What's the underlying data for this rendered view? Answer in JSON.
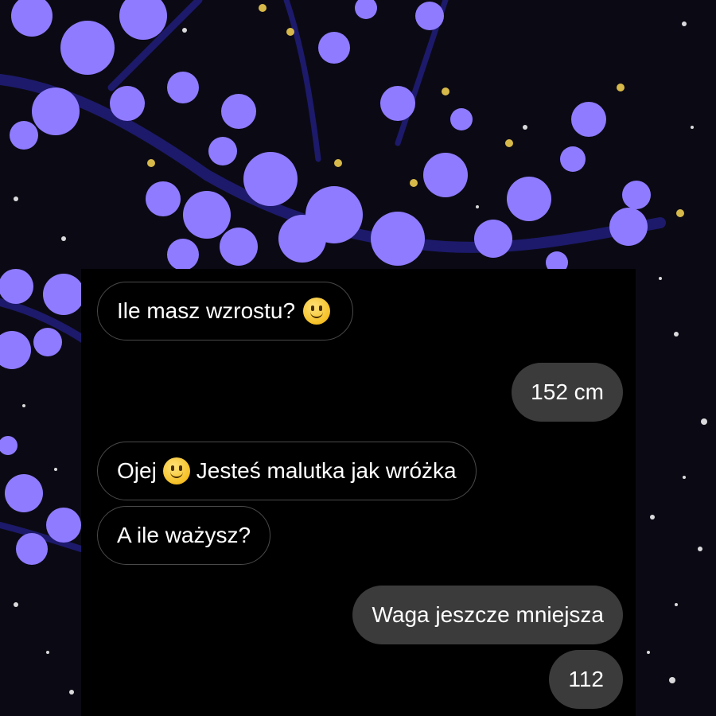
{
  "wallpaper": {
    "subject": "purple cherry blossoms at night",
    "colors": {
      "sky": "#0b0a14",
      "blossom": "#8f7bff",
      "branch": "#1d1a6b"
    }
  },
  "chat": {
    "messages": [
      {
        "side": "incoming",
        "text": "Ile masz wzrostu?",
        "emoji": "slightly-smiling-face"
      },
      {
        "side": "outgoing",
        "text": "152 cm"
      },
      {
        "side": "incoming",
        "text_before": "Ojej",
        "emoji": "slightly-smiling-face",
        "text_after": "Jesteś malutka jak wróżka"
      },
      {
        "side": "incoming",
        "text": "A ile ważysz?"
      },
      {
        "side": "outgoing",
        "text": "Waga jeszcze mniejsza"
      },
      {
        "side": "outgoing",
        "text": "112"
      }
    ]
  }
}
